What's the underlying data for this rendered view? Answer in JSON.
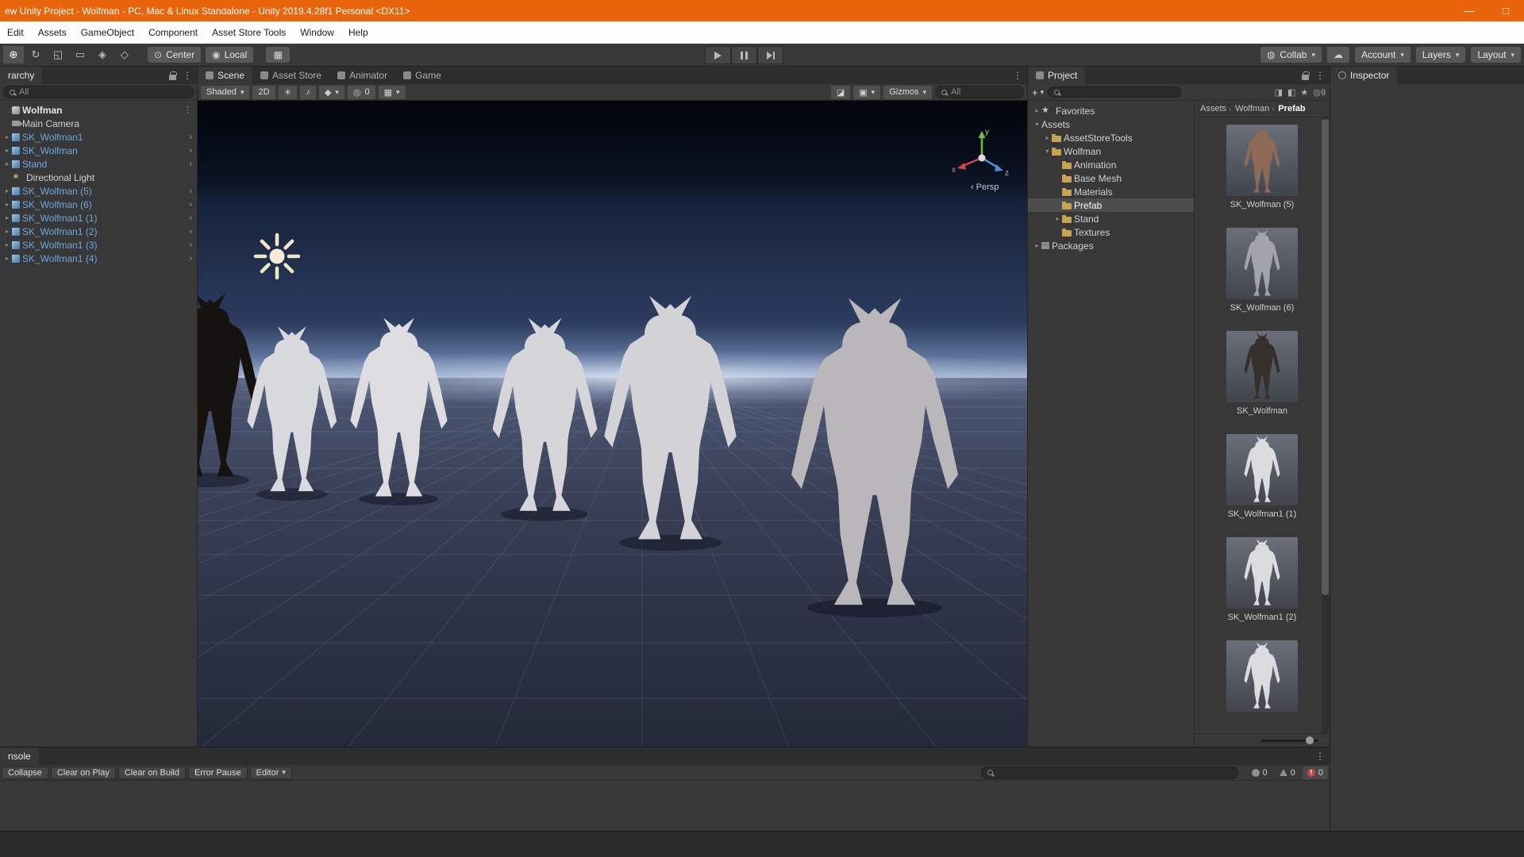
{
  "title_bar": {
    "title": "ew Unity Project - Wolfman - PC, Mac & Linux Standalone - Unity 2019.4.28f1 Personal <DX11>",
    "minimize": "—",
    "maximize": "□"
  },
  "menu": {
    "items": [
      "Edit",
      "Assets",
      "GameObject",
      "Component",
      "Asset Store Tools",
      "Window",
      "Help"
    ]
  },
  "toolbar": {
    "tools": [
      {
        "name": "move-tool-button",
        "glyph": "⊕",
        "selected": true
      },
      {
        "name": "rotate-tool-button",
        "glyph": "↻"
      },
      {
        "name": "scale-tool-button",
        "glyph": "◱"
      },
      {
        "name": "rect-tool-button",
        "glyph": "▭"
      },
      {
        "name": "transform-tool-button",
        "glyph": "◈"
      },
      {
        "name": "custom-tool-button",
        "glyph": "◇"
      }
    ],
    "pivot_label": "Center",
    "pivot_icon": "⊙",
    "space_label": "Local",
    "space_icon": "◉",
    "snap_icon": "▦",
    "collab_label": "Collab",
    "collab_icon": "◍",
    "cloud_icon": "☁",
    "account_label": "Account",
    "layers_label": "Layers",
    "layout_label": "Layout",
    "caret": "▾"
  },
  "hierarchy": {
    "tab": "rarchy",
    "search_text": "All",
    "items": [
      {
        "label": "Wolfman",
        "icon": "scene",
        "root": true,
        "chev": "⋮"
      },
      {
        "label": "Main Camera",
        "icon": "camera"
      },
      {
        "label": "SK_Wolfman1",
        "icon": "prefab",
        "blue": true,
        "expand": "▸",
        "chev": "›"
      },
      {
        "label": "SK_Wolfman",
        "icon": "prefab",
        "blue": true,
        "expand": "▸",
        "chev": "›"
      },
      {
        "label": "Stand",
        "icon": "prefab",
        "blue": true,
        "expand": "▸",
        "chev": "›"
      },
      {
        "label": "Directional Light",
        "icon": "light"
      },
      {
        "label": "SK_Wolfman (5)",
        "icon": "prefab",
        "blue": true,
        "expand": "▸",
        "chev": "›"
      },
      {
        "label": "SK_Wolfman (6)",
        "icon": "prefab",
        "blue": true,
        "expand": "▸",
        "chev": "›"
      },
      {
        "label": "SK_Wolfman1 (1)",
        "icon": "prefab",
        "blue": true,
        "expand": "▸",
        "chev": "›"
      },
      {
        "label": "SK_Wolfman1 (2)",
        "icon": "prefab",
        "blue": true,
        "expand": "▸",
        "chev": "›"
      },
      {
        "label": "SK_Wolfman1 (3)",
        "icon": "prefab",
        "blue": true,
        "expand": "▸",
        "chev": "›"
      },
      {
        "label": "SK_Wolfman1 (4)",
        "icon": "prefab",
        "blue": true,
        "expand": "▸",
        "chev": "›"
      }
    ]
  },
  "scene": {
    "tabs": [
      {
        "label": "Scene",
        "active": true
      },
      {
        "label": "Asset Store"
      },
      {
        "label": "Animator"
      },
      {
        "label": "Game"
      }
    ],
    "shaded_label": "Shaded",
    "twod_label": "2D",
    "lighting_icon": "☀",
    "audio_icon": "♪",
    "effects_icon": "◆",
    "visibility_icon": "◎",
    "hidden_count": "0",
    "grid_icon": "▦",
    "tool_settings_icon": "◪",
    "camera_icon": "▣",
    "gizmos_label": "Gizmos",
    "search_text": "All",
    "persp_label": "Persp",
    "persp_arrow": "‹",
    "axis": {
      "x": "x",
      "y": "y",
      "z": "z"
    }
  },
  "project": {
    "tab": "Project",
    "plus": "+",
    "type_icon": "◨",
    "label_icon": "◧",
    "star_icon": "★",
    "eye_icon": "◎",
    "hidden_count": "9",
    "tree": [
      {
        "label": "Favorites",
        "icon": "star",
        "arrow": "▸",
        "indent": 0
      },
      {
        "label": "Assets",
        "arrow": "▾",
        "indent": 0
      },
      {
        "label": "AssetStoreTools",
        "icon": "folder",
        "arrow": "▸",
        "indent": 1
      },
      {
        "label": "Wolfman",
        "icon": "folder",
        "arrow": "▾",
        "indent": 1
      },
      {
        "label": "Animation",
        "icon": "folder",
        "indent": 2
      },
      {
        "label": "Base Mesh",
        "icon": "folder",
        "indent": 2
      },
      {
        "label": "Materials",
        "icon": "folder",
        "indent": 2
      },
      {
        "label": "Prefab",
        "icon": "folder",
        "indent": 2,
        "selected": true
      },
      {
        "label": "Stand",
        "icon": "folder",
        "arrow": "▸",
        "indent": 2
      },
      {
        "label": "Textures",
        "icon": "folder",
        "indent": 2
      },
      {
        "label": "Packages",
        "icon": "package",
        "arrow": "▸",
        "indent": 0
      }
    ],
    "breadcrumb": [
      {
        "label": "Assets",
        "sep": "›"
      },
      {
        "label": "Wolfman",
        "sep": "›"
      },
      {
        "label": "Prefab",
        "last": true
      }
    ],
    "thumbs": [
      {
        "label": "SK_Wolfman (5)",
        "tint": "#8d6a57"
      },
      {
        "label": "SK_Wolfman (6)",
        "tint": "#a3a3ab"
      },
      {
        "label": "SK_Wolfman",
        "tint": "#35302c"
      },
      {
        "label": "SK_Wolfman1 (1)",
        "tint": "#dcdce0"
      },
      {
        "label": "SK_Wolfman1 (2)",
        "tint": "#dcdce0"
      },
      {
        "label": "",
        "tint": "#dcdce0"
      }
    ]
  },
  "inspector": {
    "tab": "Inspector"
  },
  "console": {
    "tab": "nsole",
    "buttons": [
      "Collapse",
      "Clear on Play",
      "Clear on Build",
      "Error Pause"
    ],
    "editor_label": "Editor",
    "caret": "▾",
    "counts": {
      "info": "0",
      "warn": "0",
      "error": "0"
    }
  },
  "icons": {
    "kebab": "⋮",
    "caret": "▾"
  }
}
